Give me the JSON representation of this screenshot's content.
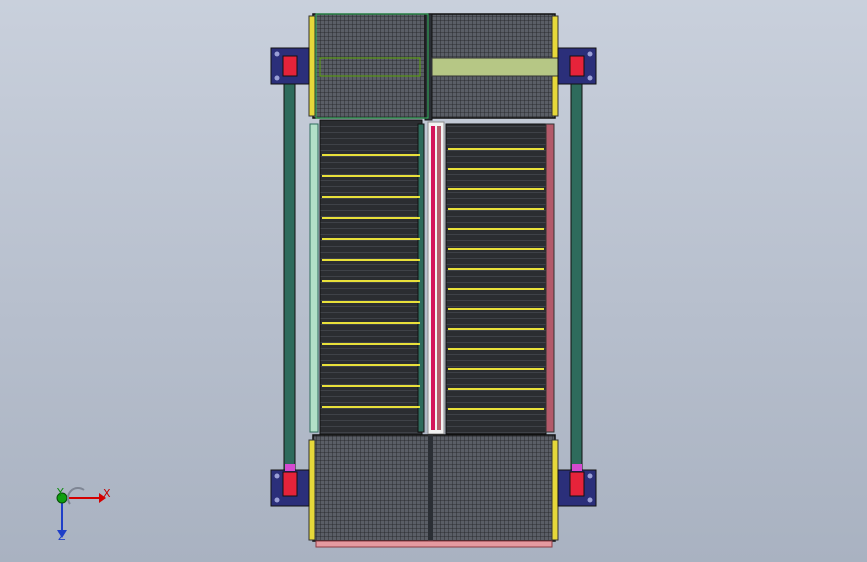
{
  "viewport": {
    "background_top": "#c9d0dc",
    "background_bottom": "#a9b2c1"
  },
  "triad": {
    "x_label": "X",
    "y_label": "Y",
    "z_label": "Z",
    "x_color": "#d40000",
    "y_color": "#0fa00f",
    "z_color": "#1f3fc8"
  },
  "model": {
    "frame_color": "#2e6b5c",
    "belt_color": "#2a2a2a",
    "mesh_color": "#3a3a3a",
    "slat_color": "#e8e03a",
    "bracket_color": "#2b2f7a",
    "accent_color": "#d4145a",
    "guide_color": "#b35a6a"
  }
}
